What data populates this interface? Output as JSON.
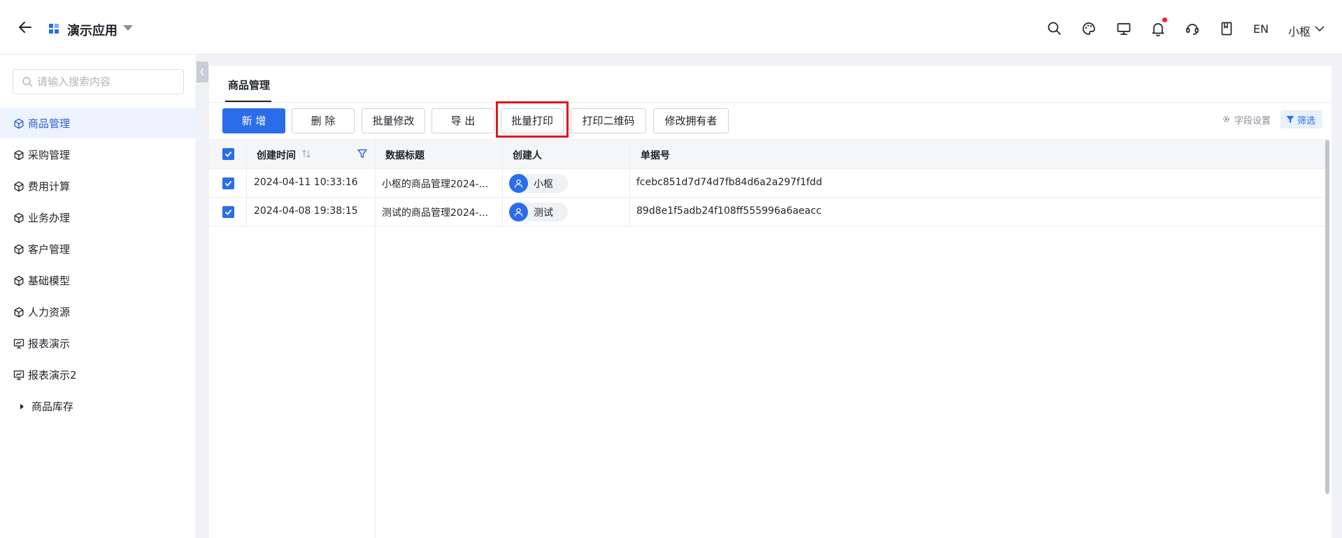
{
  "header": {
    "app_title": "演示应用",
    "lang_label": "EN",
    "user_label": "小枢"
  },
  "sidebar": {
    "search_placeholder": "请输入搜索内容",
    "items": [
      {
        "label": "商品管理",
        "icon": "cube-icon",
        "active": true
      },
      {
        "label": "采购管理",
        "icon": "cube-icon"
      },
      {
        "label": "费用计算",
        "icon": "cube-icon"
      },
      {
        "label": "业务办理",
        "icon": "cube-icon"
      },
      {
        "label": "客户管理",
        "icon": "cube-icon"
      },
      {
        "label": "基础模型",
        "icon": "cube-icon"
      },
      {
        "label": "人力资源",
        "icon": "cube-icon"
      },
      {
        "label": "报表演示",
        "icon": "report-icon"
      },
      {
        "label": "报表演示2",
        "icon": "report-icon"
      },
      {
        "label": "商品库存",
        "icon": "caret-right-icon"
      }
    ]
  },
  "main": {
    "tab_label": "商品管理",
    "toolbar": {
      "add_label": "新 增",
      "delete_label": "删 除",
      "batch_edit_label": "批量修改",
      "export_label": "导 出",
      "batch_print_label": "批量打印",
      "print_qr_label": "打印二维码",
      "change_owner_label": "修改拥有者",
      "field_settings_label": "字段设置",
      "filter_label": "筛选"
    },
    "table": {
      "columns": [
        "创建时间",
        "数据标题",
        "创建人",
        "单据号"
      ],
      "rows": [
        {
          "created_at": "2024-04-11 10:33:16",
          "title": "小枢的商品管理2024-...",
          "creator": "小枢",
          "doc_no": "fcebc851d7d74d7fb84d6a2a297f1fdd",
          "checked": true
        },
        {
          "created_at": "2024-04-08 19:38:15",
          "title": "测试的商品管理2024-...",
          "creator": "测试",
          "doc_no": "89d8e1f5adb24f108ff555996a6aeacc",
          "checked": true
        }
      ]
    }
  },
  "colors": {
    "accent": "#2b6de9",
    "highlight": "#e0161c",
    "notification_dot": "#f5222d"
  }
}
